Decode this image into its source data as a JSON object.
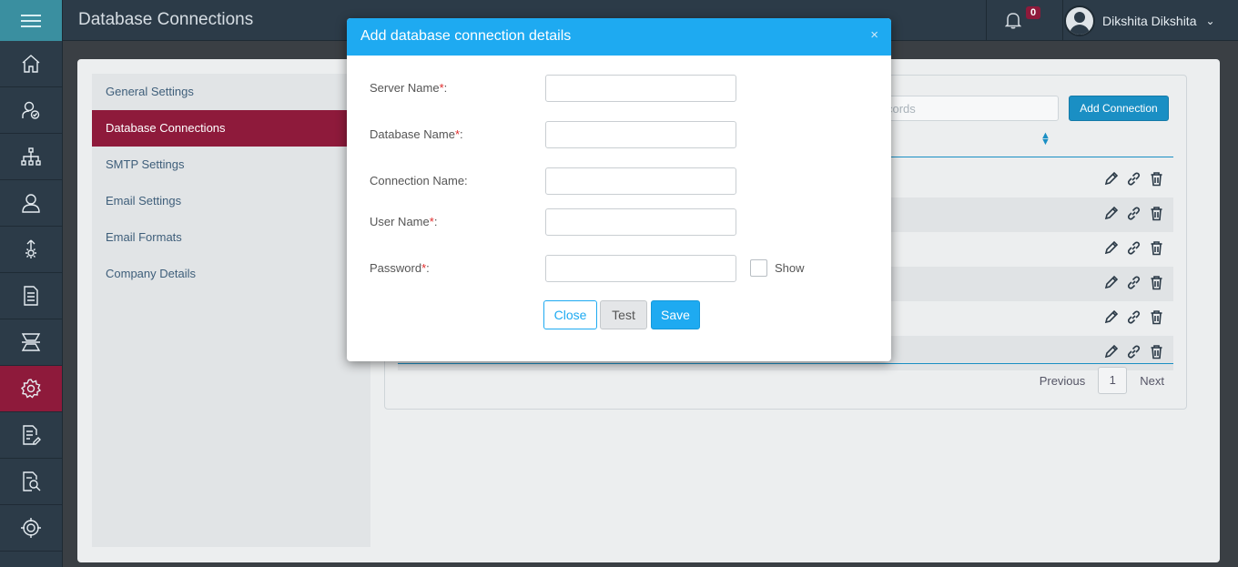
{
  "app": {
    "page_title": "Database Connections"
  },
  "header": {
    "notification_count": "0",
    "user_name": "Dikshita Dikshita"
  },
  "sidebar": {
    "items": [
      {
        "icon": "home-icon"
      },
      {
        "icon": "user-shield-icon"
      },
      {
        "icon": "org-chart-icon"
      },
      {
        "icon": "user-icon"
      },
      {
        "icon": "upload-gear-icon"
      },
      {
        "icon": "document-icon"
      },
      {
        "icon": "scanner-icon"
      },
      {
        "icon": "settings-icon",
        "active": true
      },
      {
        "icon": "document-edit-icon"
      },
      {
        "icon": "document-search-icon"
      },
      {
        "icon": "target-icon"
      }
    ]
  },
  "settings_menu": {
    "items": [
      {
        "label": "General Settings"
      },
      {
        "label": "Database Connections",
        "active": true
      },
      {
        "label": "SMTP Settings"
      },
      {
        "label": "Email Settings"
      },
      {
        "label": "Email Formats"
      },
      {
        "label": "Company Details"
      }
    ]
  },
  "content": {
    "search_placeholder": "cords",
    "add_button_label": "Add Connection",
    "row_count": 6,
    "pager": {
      "previous": "Previous",
      "page": "1",
      "next": "Next"
    }
  },
  "modal": {
    "title": "Add database connection details",
    "close_icon": "×",
    "fields": {
      "server_name": {
        "label": "Server Name",
        "required_mark": "*",
        "suffix": ":",
        "value": ""
      },
      "database_name": {
        "label": "Database Name",
        "required_mark": "*",
        "suffix": ":",
        "value": ""
      },
      "connection_name": {
        "label": "Connection Name:",
        "value": ""
      },
      "user_name": {
        "label": "User Name",
        "required_mark": "*",
        "suffix": ":",
        "value": ""
      },
      "password": {
        "label": "Password",
        "required_mark": "*",
        "suffix": ":",
        "value": ""
      }
    },
    "show_label": "Show",
    "buttons": {
      "close": "Close",
      "test": "Test",
      "save": "Save"
    }
  },
  "colors": {
    "accent": "#1eaaf1",
    "active_nav": "#8e1a3b",
    "sidebar_bg": "#2c3b48"
  }
}
